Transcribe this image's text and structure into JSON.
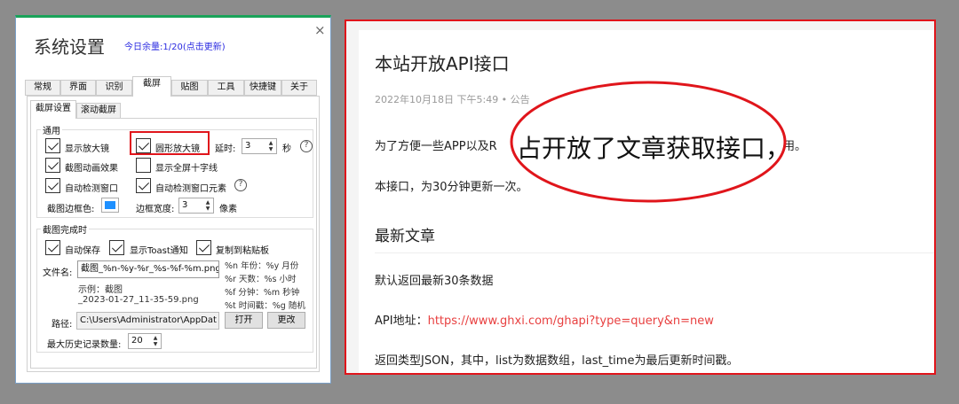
{
  "dialog": {
    "title": "系统设置",
    "quota_link": "今日余量:1/20(点击更新)",
    "close": "×",
    "tabs": [
      "常规",
      "界面",
      "识别",
      "截屏",
      "贴图",
      "工具",
      "快捷键",
      "关于"
    ],
    "active_tab": "截屏",
    "subtabs": [
      "截屏设置",
      "滚动截屏"
    ],
    "general": {
      "label": "通用",
      "show_magnifier": {
        "label": "显示放大镜",
        "checked": true
      },
      "round_magnifier": {
        "label": "圆形放大镜",
        "checked": true
      },
      "delay_label": "延时:",
      "delay_value": "3",
      "delay_unit": "秒",
      "anim": {
        "label": "截图动画效果",
        "checked": true
      },
      "crosshair": {
        "label": "显示全屏十字线",
        "checked": false
      },
      "detect_window": {
        "label": "自动检测窗口",
        "checked": true
      },
      "detect_element": {
        "label": "自动检测窗口元素",
        "checked": true
      },
      "border_color_label": "截图边框色:",
      "border_color": "#1e90ff",
      "border_width_label": "边框宽度:",
      "border_width_value": "3",
      "border_width_unit": "像素",
      "help": "?"
    },
    "on_complete": {
      "label": "截图完成时",
      "auto_save": {
        "label": "自动保存",
        "checked": true
      },
      "toast": {
        "label": "显示Toast通知",
        "checked": true
      },
      "clipboard": {
        "label": "复制到粘贴板",
        "checked": true
      },
      "filename_label": "文件名:",
      "filename_value": "截图_%n-%y-%r_%s-%f-%m.png",
      "example_line1": "示例：截图",
      "example_line2": "_2023-01-27_11-35-59.png",
      "hints": [
        "%n 年份：%y 月份",
        "%r 天数：%s 小时",
        "%f 分钟：%m 秒钟",
        "%t 时间戳：%g 随机"
      ],
      "path_label": "路径:",
      "path_value": "C:\\Users\\Administrator\\AppDat",
      "open_button": "打开",
      "change_button": "更改",
      "history_label": "最大历史记录数量:",
      "history_value": "20"
    }
  },
  "article": {
    "title": "本站开放API接口",
    "meta": "2022年10月18日 下午5:49 • 公告",
    "para1_left": "为了方便一些APP以及R",
    "para1_right": "用。",
    "magnified_text": "占开放了文章获取接口，",
    "para2": "本接口，为30分钟更新一次。",
    "section_title": "最新文章",
    "para3": "默认返回最新30条数据",
    "api_label": "API地址：",
    "api_url": "https://www.ghxi.com/ghapi?type=query&n=new",
    "para4": "返回类型JSON，其中，list为数据数组，last_time为最后更新时间戳。"
  },
  "colors": {
    "accent_red": "#e0151b",
    "link_blue": "#2a2ae0",
    "url_red": "#e84040"
  }
}
